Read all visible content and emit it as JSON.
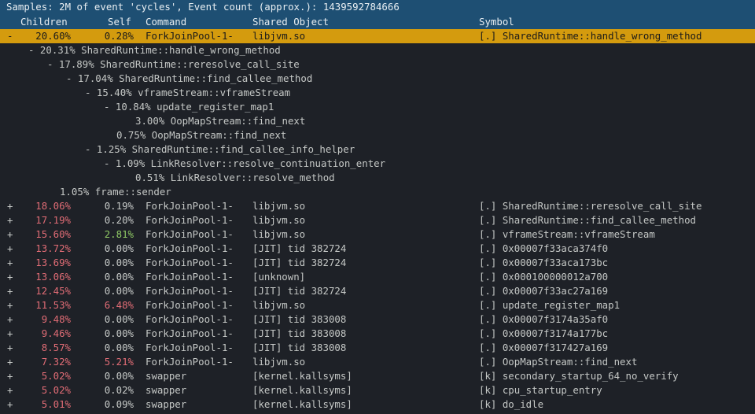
{
  "title": "Samples: 2M of event 'cycles', Event count (approx.): 1439592784666",
  "headers": {
    "children": "Children",
    "self": "Self",
    "command": "Command",
    "object": "Shared Object",
    "symbol": "Symbol"
  },
  "selected": {
    "marker": "-",
    "children": "20.60%",
    "self": "0.28%",
    "command": "ForkJoinPool-1-",
    "object": "libjvm.so",
    "symbol": "[.] SharedRuntime::handle_wrong_method"
  },
  "tree": [
    {
      "indent": 3,
      "text": "- 20.31% SharedRuntime::handle_wrong_method"
    },
    {
      "indent": 6,
      "text": "- 17.89% SharedRuntime::reresolve_call_site"
    },
    {
      "indent": 9,
      "text": "- 17.04% SharedRuntime::find_callee_method"
    },
    {
      "indent": 12,
      "text": "- 15.40% vframeStream::vframeStream"
    },
    {
      "indent": 15,
      "text": "- 10.84% update_register_map1"
    },
    {
      "indent": 20,
      "text": "3.00% OopMapStream::find_next"
    },
    {
      "indent": 17,
      "text": "0.75% OopMapStream::find_next"
    },
    {
      "indent": 12,
      "text": "- 1.25% SharedRuntime::find_callee_info_helper"
    },
    {
      "indent": 15,
      "text": "- 1.09% LinkResolver::resolve_continuation_enter"
    },
    {
      "indent": 20,
      "text": "0.51% LinkResolver::resolve_method"
    },
    {
      "indent": 8,
      "text": "1.05% frame::sender"
    }
  ],
  "rows": [
    {
      "marker": "+",
      "children": "18.06%",
      "self": "0.19%",
      "command": "ForkJoinPool-1-",
      "object": "libjvm.so",
      "symbol": "[.] SharedRuntime::reresolve_call_site",
      "cc": "red",
      "sc": "white"
    },
    {
      "marker": "+",
      "children": "17.19%",
      "self": "0.20%",
      "command": "ForkJoinPool-1-",
      "object": "libjvm.so",
      "symbol": "[.] SharedRuntime::find_callee_method",
      "cc": "red",
      "sc": "white"
    },
    {
      "marker": "+",
      "children": "15.60%",
      "self": "2.81%",
      "command": "ForkJoinPool-1-",
      "object": "libjvm.so",
      "symbol": "[.] vframeStream::vframeStream",
      "cc": "red",
      "sc": "green"
    },
    {
      "marker": "+",
      "children": "13.72%",
      "self": "0.00%",
      "command": "ForkJoinPool-1-",
      "object": "[JIT] tid 382724",
      "symbol": "[.] 0x00007f33aca374f0",
      "cc": "red",
      "sc": "white"
    },
    {
      "marker": "+",
      "children": "13.69%",
      "self": "0.00%",
      "command": "ForkJoinPool-1-",
      "object": "[JIT] tid 382724",
      "symbol": "[.] 0x00007f33aca173bc",
      "cc": "red",
      "sc": "white"
    },
    {
      "marker": "+",
      "children": "13.06%",
      "self": "0.00%",
      "command": "ForkJoinPool-1-",
      "object": "[unknown]",
      "symbol": "[.] 0x000100000012a700",
      "cc": "red",
      "sc": "white"
    },
    {
      "marker": "+",
      "children": "12.45%",
      "self": "0.00%",
      "command": "ForkJoinPool-1-",
      "object": "[JIT] tid 382724",
      "symbol": "[.] 0x00007f33ac27a169",
      "cc": "red",
      "sc": "white"
    },
    {
      "marker": "+",
      "children": "11.53%",
      "self": "6.48%",
      "command": "ForkJoinPool-1-",
      "object": "libjvm.so",
      "symbol": "[.] update_register_map1",
      "cc": "red",
      "sc": "red"
    },
    {
      "marker": "+",
      "children": "9.48%",
      "self": "0.00%",
      "command": "ForkJoinPool-1-",
      "object": "[JIT] tid 383008",
      "symbol": "[.] 0x00007f3174a35af0",
      "cc": "red",
      "sc": "white"
    },
    {
      "marker": "+",
      "children": "9.46%",
      "self": "0.00%",
      "command": "ForkJoinPool-1-",
      "object": "[JIT] tid 383008",
      "symbol": "[.] 0x00007f3174a177bc",
      "cc": "red",
      "sc": "white"
    },
    {
      "marker": "+",
      "children": "8.57%",
      "self": "0.00%",
      "command": "ForkJoinPool-1-",
      "object": "[JIT] tid 383008",
      "symbol": "[.] 0x00007f317427a169",
      "cc": "red",
      "sc": "white"
    },
    {
      "marker": "+",
      "children": "7.32%",
      "self": "5.21%",
      "command": "ForkJoinPool-1-",
      "object": "libjvm.so",
      "symbol": "[.] OopMapStream::find_next",
      "cc": "red",
      "sc": "red"
    },
    {
      "marker": "+",
      "children": "5.02%",
      "self": "0.00%",
      "command": "swapper",
      "object": "[kernel.kallsyms]",
      "symbol": "[k] secondary_startup_64_no_verify",
      "cc": "red",
      "sc": "white"
    },
    {
      "marker": "+",
      "children": "5.02%",
      "self": "0.02%",
      "command": "swapper",
      "object": "[kernel.kallsyms]",
      "symbol": "[k] cpu_startup_entry",
      "cc": "red",
      "sc": "white"
    },
    {
      "marker": "+",
      "children": "5.01%",
      "self": "0.09%",
      "command": "swapper",
      "object": "[kernel.kallsyms]",
      "symbol": "[k] do_idle",
      "cc": "red",
      "sc": "white"
    }
  ],
  "colors": {
    "background": "#1e2127",
    "header": "#1e4f73",
    "selection": "#d49b0e",
    "hot": "#e06c75",
    "warm": "#8fc965"
  }
}
